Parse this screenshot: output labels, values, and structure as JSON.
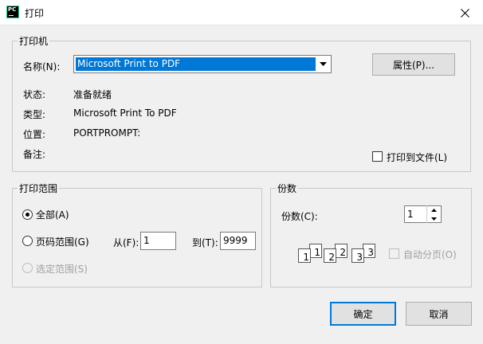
{
  "window": {
    "title": "打印",
    "icon": "pycharm-icon",
    "close_icon": "close-icon"
  },
  "printer_group": {
    "legend": "打印机",
    "name_label": "名称(N):",
    "name_value": "Microsoft Print to PDF",
    "properties_button": "属性(P)...",
    "status_label": "状态:",
    "status_value": "准备就绪",
    "type_label": "类型:",
    "type_value": "Microsoft Print To PDF",
    "location_label": "位置:",
    "location_value": "PORTPROMPT:",
    "comment_label": "备注:",
    "print_to_file_label": "打印到文件(L)"
  },
  "range_group": {
    "legend": "打印范围",
    "all_label": "全部(A)",
    "pages_label": "页码范围(G)",
    "from_label": "从(F):",
    "from_value": "1",
    "to_label": "到(T):",
    "to_value": "9999",
    "selection_label": "选定范围(S)"
  },
  "copies_group": {
    "legend": "份数",
    "copies_label": "份数(C):",
    "copies_value": "1",
    "collate_label": "自动分页(O)",
    "collate_pages": [
      "1",
      "1",
      "2",
      "2",
      "3",
      "3"
    ]
  },
  "footer": {
    "ok_button": "确定",
    "cancel_button": "取消"
  },
  "colors": {
    "accent": "#0078d7",
    "background": "#f0f0f0",
    "disabled": "#a0a0a0"
  }
}
